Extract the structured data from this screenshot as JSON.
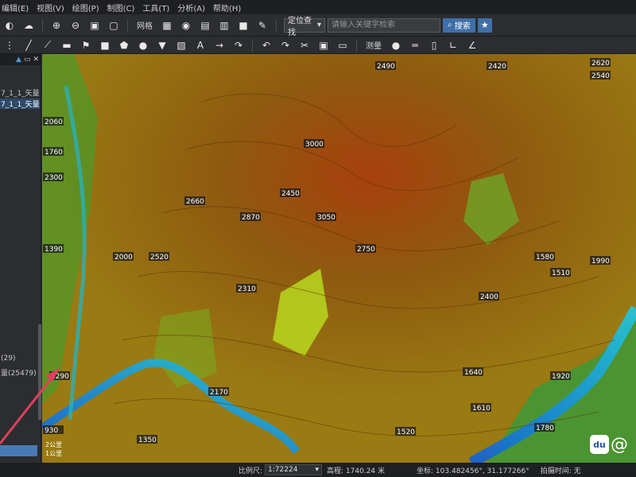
{
  "menu": [
    {
      "label": "编辑(E)"
    },
    {
      "label": "视图(V)"
    },
    {
      "label": "绘图(P)"
    },
    {
      "label": "制图(C)"
    },
    {
      "label": "工具(T)"
    },
    {
      "label": "分析(A)"
    },
    {
      "label": "帮助(H)"
    }
  ],
  "toolbar": {
    "grid_label": "网格",
    "locate_combo": "定位查找",
    "search_placeholder": "请输入关键字检索",
    "search_button": "搜索",
    "measure_label": "测量"
  },
  "layers_panel": {
    "items": [
      {
        "label": "7_1_1_矢量..."
      },
      {
        "label": "7_1_1_矢量..."
      },
      {
        "label": "(29)"
      },
      {
        "label": "量(25479)"
      }
    ]
  },
  "map": {
    "contour_labels": [
      {
        "text": "3000"
      },
      {
        "text": "3050"
      },
      {
        "text": "2870"
      },
      {
        "text": "2660"
      },
      {
        "text": "2520"
      },
      {
        "text": "2450"
      },
      {
        "text": "2310"
      },
      {
        "text": "2750"
      },
      {
        "text": "2490"
      },
      {
        "text": "2420"
      },
      {
        "text": "2540"
      },
      {
        "text": "2620"
      },
      {
        "text": "2060"
      },
      {
        "text": "1760"
      },
      {
        "text": "2300"
      },
      {
        "text": "1390"
      },
      {
        "text": "1990"
      },
      {
        "text": "1580"
      },
      {
        "text": "1510"
      },
      {
        "text": "2400"
      },
      {
        "text": "1640"
      },
      {
        "text": "1520"
      },
      {
        "text": "1920"
      },
      {
        "text": "1780"
      },
      {
        "text": "930"
      },
      {
        "text": "1290"
      },
      {
        "text": "1610"
      },
      {
        "text": "2000"
      },
      {
        "text": "1350"
      },
      {
        "text": "2170"
      }
    ],
    "scale_text": [
      "2公里",
      "1公里"
    ]
  },
  "status": {
    "scale_label": "比例尺:",
    "scale_value": "1:72224",
    "elevation": "高程: 1740.24 米",
    "coords": "坐标: 103.482456°, 31.177266°",
    "capture_time": "拍摄时间: 无"
  },
  "colors": {
    "accent": "#3f6fa8",
    "annotation_arrow": "#e0405a",
    "terrain_high": "#8a4a10",
    "terrain_mid": "#c9a20e",
    "terrain_low": "#2a8ad8"
  }
}
